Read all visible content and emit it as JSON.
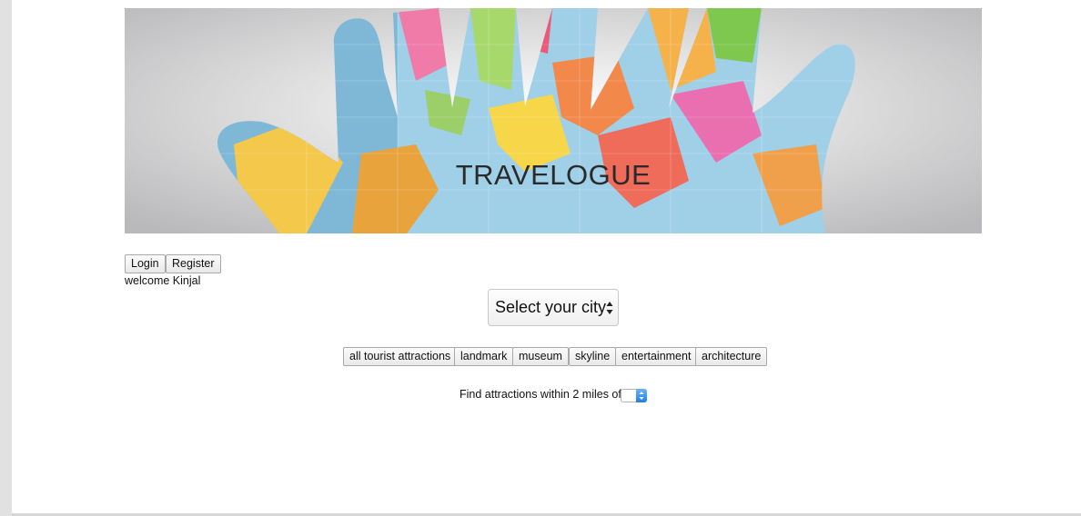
{
  "banner": {
    "title": "TRAVELOGUE"
  },
  "auth": {
    "login_label": "Login",
    "register_label": "Register",
    "welcome_text": "welcome Kinjal"
  },
  "city_select": {
    "selected": "Select your city",
    "icon": "updown-arrows-icon"
  },
  "filters": [
    {
      "label": "all tourist attractions"
    },
    {
      "label": "landmark"
    },
    {
      "label": "museum"
    },
    {
      "label": "skyline"
    },
    {
      "label": "entertainment"
    },
    {
      "label": "architecture"
    }
  ],
  "radius": {
    "label": "Find attractions within 2 miles of :",
    "selected": ""
  },
  "colors": {
    "accent_blue": "#1f7ee8",
    "page_bg": "#ffffff",
    "rail": "#e1e1e1"
  }
}
